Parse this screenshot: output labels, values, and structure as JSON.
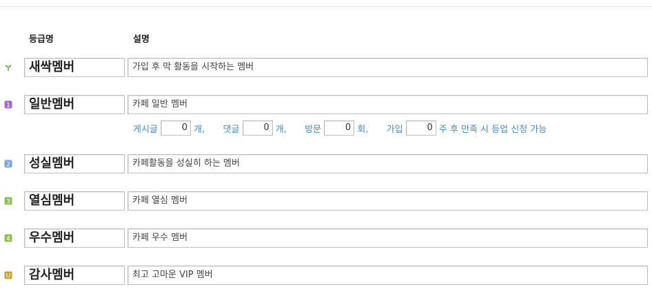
{
  "headers": {
    "grade_name": "등급명",
    "description": "설명"
  },
  "rows": [
    {
      "name": "새싹멤버",
      "desc": "가입 후 막 활동을 시작하는 멤버",
      "icon": "sprout-icon",
      "color": "#6aa84f",
      "badge": ""
    },
    {
      "name": "일반멤버",
      "desc": "카페 일반 멤버",
      "icon": "level-1-icon",
      "color": "#a26acb",
      "badge": "1"
    },
    {
      "name": "성실멤버",
      "desc": "카페활동을 성실히 하는 멤버",
      "icon": "level-2-icon",
      "color": "#7aa5e0",
      "badge": "2"
    },
    {
      "name": "열심멤버",
      "desc": "카페 열심 멤버",
      "icon": "level-3-icon",
      "color": "#8cbf4e",
      "badge": "3"
    },
    {
      "name": "우수멤버",
      "desc": "카페 우수 멤버",
      "icon": "level-4-icon",
      "color": "#8cbf4e",
      "badge": "4"
    },
    {
      "name": "감사멤버",
      "desc": "최고 고마운 VIP 멤버",
      "icon": "level-u-icon",
      "color": "#c9a338",
      "badge": "U"
    }
  ],
  "promotion": {
    "posts_label": "게시글",
    "posts_value": "0",
    "posts_unit": "개,",
    "comments_label": "댓글",
    "comments_value": "0",
    "comments_unit": "개,",
    "visits_label": "방문",
    "visits_value": "0",
    "visits_unit": "회,",
    "join_label": "가입",
    "join_value": "0",
    "join_suffix": "주 후 만족 시 등업 신청 가능"
  }
}
